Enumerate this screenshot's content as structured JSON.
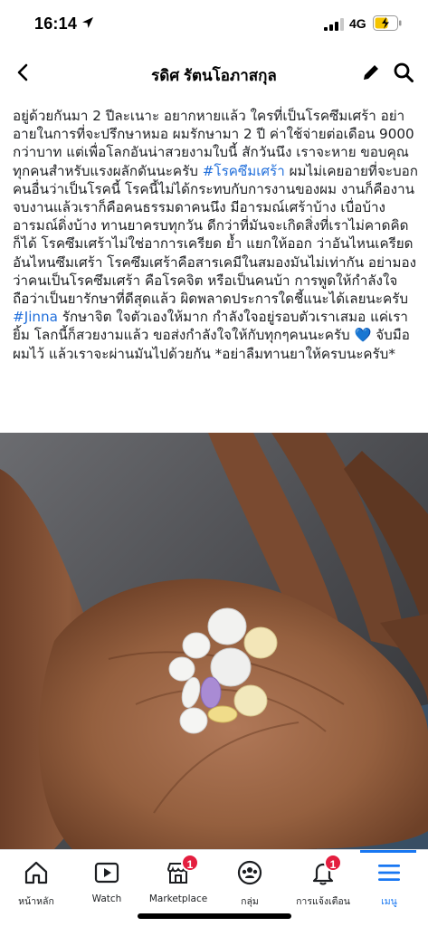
{
  "status_bar": {
    "time": "16:14",
    "network": "4G",
    "icons": [
      "location-arrow-icon",
      "signal-icon",
      "battery-charging-icon"
    ]
  },
  "header": {
    "title": "รดิศ รัตนโอภาสกุล",
    "icons": [
      "back-icon",
      "edit-icon",
      "search-icon"
    ]
  },
  "post": {
    "segments": [
      "อยู่ด้วยกันมา 2 ปีละเนาะ อยากหายแล้ว ใครที่เป็นโรคซึมเศร้า อย่าอายในการที่จะปรึกษาหมอ ผมรักษามา 2 ปี ค่าใช้จ่ายต่อเดือน 9000 กว่าบาท แต่เพื่อโลกอันน่าสวยงามใบนี้ สักวันนึง เราจะหาย ขอบคุณทุกคนสำหรับแรงผลักดันนะครับ ",
      "#โรคซึมเศร้า",
      " ผมไม่เคยอายที่จะบอกคนอื่นว่าเป็นโรคนี้ โรคนี้ไม่ได้กระทบกับการงานของผม งานก็คืองาน จบงานแล้วเราก็คือคนธรรมดาคนนึง มีอารมณ์เศร้าบ้าง เบื่อบ้าง อารมณ์ดิ่งบ้าง ทานยาครบทุกวัน ดีกว่าที่มันจะเกิดสิ่งที่เราไม่คาดคิดก็ได้ โรคซึมเศร้าไม่ใช่อาการเครียด ย้ำ แยกให้ออก ว่าอันไหนเครียด อันไหนซึมเศร้า โรคซึมเศร้าคือสารเคมีในสมองมันไม่เท่ากัน อย่ามองว่าคนเป็นโรคซึมเศร้า คือโรคจิต หรือเป็นคนบ้า การพูดให้กำลังใจ ถือว่าเป็นยารักษาที่ดีสุดแล้ว ผิดพลาดประการใดชี้แนะได้เลยนะครับ ",
      "#Jinna",
      " รักษาจิต ใจตัวเองให้มาก กำลังใจอยู่รอบตัวเราเสมอ แค่เรายิ้ม โลกนี้ก็สวยงามแล้ว ขอส่งกำลังใจให้กับทุกๆคนนะครับ 💙 จับมือผมไว้ แล้วเราจะผ่านมันไปด้วยกัน *อย่าลืมทานยาให้ครบนะครับ*"
    ],
    "hashtag_color": "#216fdb",
    "photo_description_icon": "pills-in-hand-photo"
  },
  "bottom_nav": {
    "items": [
      {
        "label": "หน้าหลัก",
        "icon": "home-icon",
        "badge": ""
      },
      {
        "label": "Watch",
        "icon": "watch-video-icon",
        "badge": ""
      },
      {
        "label": "Marketplace",
        "icon": "marketplace-shop-icon",
        "badge": "1"
      },
      {
        "label": "กลุ่ม",
        "icon": "groups-icon",
        "badge": ""
      },
      {
        "label": "การแจ้งเตือน",
        "icon": "bell-icon",
        "badge": "1"
      },
      {
        "label": "เมนู",
        "icon": "menu-icon",
        "badge": ""
      }
    ],
    "active_color": "#1877f2",
    "badge_color": "#e41e3f"
  }
}
